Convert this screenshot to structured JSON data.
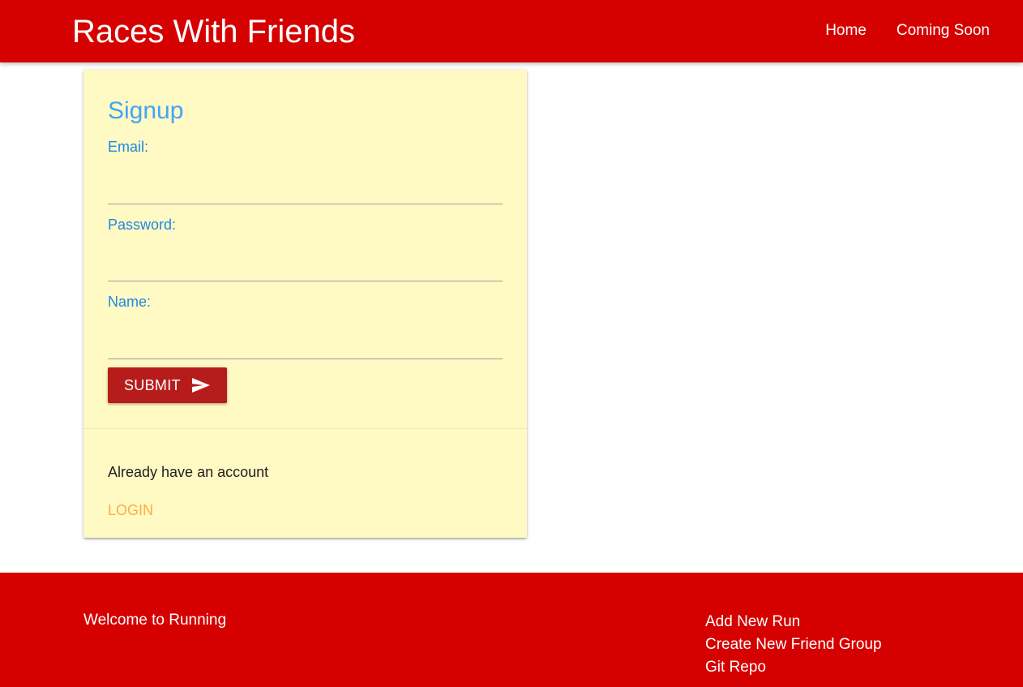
{
  "header": {
    "brand": "Races With Friends",
    "nav": [
      {
        "label": "Home"
      },
      {
        "label": "Coming Soon"
      }
    ]
  },
  "signup": {
    "title": "Signup",
    "fields": [
      {
        "label": "Email:",
        "value": "",
        "placeholder": ""
      },
      {
        "label": "Password:",
        "value": "",
        "placeholder": ""
      },
      {
        "label": "Name:",
        "value": "",
        "placeholder": ""
      }
    ],
    "submit_label": "SUBMIT",
    "submit_icon": "send-icon",
    "account_prompt": "Already have an account",
    "login_label": "LOGIN"
  },
  "footer": {
    "welcome": "Welcome to Running",
    "links": [
      {
        "label": "Add New Run"
      },
      {
        "label": "Create New Friend Group"
      },
      {
        "label": "Git Repo"
      }
    ]
  },
  "colors": {
    "brand_red": "#d50000",
    "card_bg": "#fff9c4",
    "label_blue": "#1e88e5",
    "title_blue": "#42a5f5",
    "button_red": "#b71c1c",
    "login_orange": "#ffab40"
  }
}
